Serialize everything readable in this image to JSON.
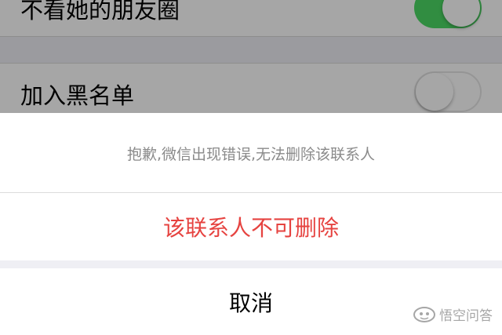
{
  "settings": {
    "moments_label": "不看她的朋友圈",
    "moments_toggle": "on",
    "blacklist_label": "加入黑名单",
    "blacklist_toggle": "off"
  },
  "action_sheet": {
    "message": "抱歉,微信出现错误,无法删除该联系人",
    "destructive_label": "该联系人不可删除",
    "cancel_label": "取消"
  },
  "watermark": {
    "text": "悟空问答",
    "icon": "wukong-logo-icon"
  },
  "colors": {
    "toggle_on": "#4cd964",
    "destructive": "#e64340",
    "message_text": "#8a8a8a"
  }
}
